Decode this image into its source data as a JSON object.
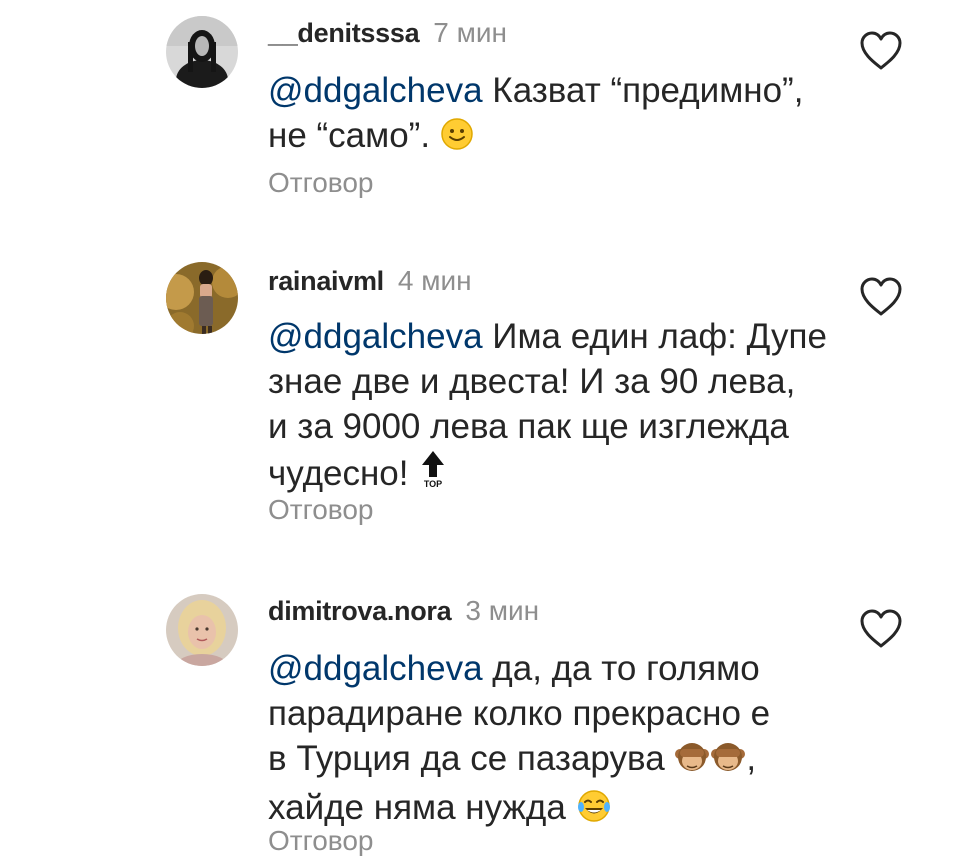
{
  "colors": {
    "text": "#262626",
    "secondary": "#8e8e8e",
    "mention": "#00376b"
  },
  "comments": [
    {
      "username": "__denitsssa",
      "time": "7 мин",
      "mention": "@ddgalcheva",
      "line1_rest": " Казват “предимно”,",
      "line2": "не “само”.",
      "emoji": "slightly-smiling-face",
      "reply": "Отговор",
      "like_icon": "heart-outline-icon",
      "avatar": "dark-haired-person-avatar"
    },
    {
      "username": "rainaivml",
      "time": "4 мин",
      "mention": "@ddgalcheva",
      "line1_rest": " Има един лаф: Дупе",
      "line2": "знае две и двеста! И за 90 лева,",
      "line3": "и за 9000 лева пак ще изглежда",
      "line4": "чудесно!",
      "emoji": "top-arrow",
      "reply": "Отговор",
      "like_icon": "heart-outline-icon",
      "avatar": "woman-golden-background-avatar"
    },
    {
      "username": "dimitrova.nora",
      "time": "3 мин",
      "mention": "@ddgalcheva",
      "line1_rest": " да, да то голямо",
      "line2": "парадиране колко прекрасно е",
      "line3_prefix": "в Турция да се пазарува",
      "line3_suffix": ",",
      "line4": "хайде няма нужда",
      "emoji": "see-no-evil-monkey, face-with-tears-of-joy",
      "reply": "Отговор",
      "like_icon": "heart-outline-icon",
      "avatar": "blonde-woman-avatar"
    }
  ]
}
